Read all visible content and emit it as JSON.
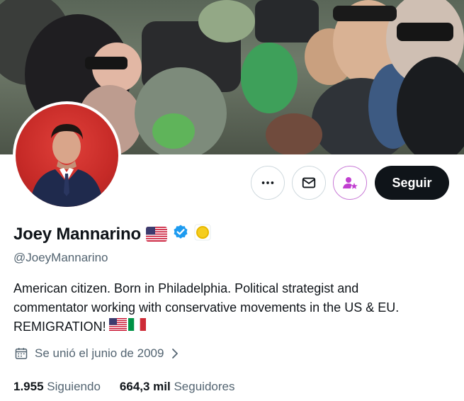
{
  "profile": {
    "display_name": "Joey Mannarino",
    "handle": "@JoeyMannarino",
    "bio_line1": "American citizen. Born in Philadelphia. Political strategist and",
    "bio_line2": "commentator working with conservative movements in the US & EU.",
    "bio_line3": "REMIGRATION!",
    "joined": "Se unió el junio de 2009",
    "following_count": "1.955",
    "following_label": "Siguiendo",
    "followers_count": "664,3 mil",
    "followers_label": "Seguidores"
  },
  "actions": {
    "follow_label": "Seguir"
  },
  "icons": {
    "more": "more-icon",
    "message": "envelope-icon",
    "subscribe": "subscribe-icon",
    "verified": "verified-badge-icon",
    "affiliate": "gold-circle-icon",
    "calendar": "calendar-icon",
    "chevron": "chevron-right-icon"
  },
  "colors": {
    "verified": "#1d9bf0",
    "follow_bg": "#0f1419",
    "subscribe_accent": "#c879d6",
    "muted": "#536471"
  }
}
